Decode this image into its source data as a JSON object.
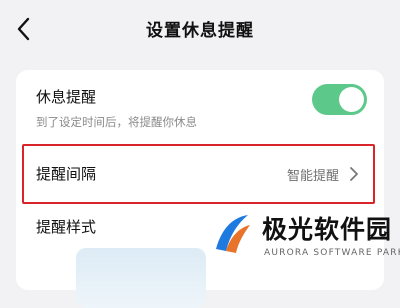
{
  "header": {
    "back_icon": "chevron-left-icon",
    "title": "设置休息提醒"
  },
  "rest_reminder": {
    "title": "休息提醒",
    "description": "到了设定时间后，将提醒你休息",
    "toggle_on": true,
    "toggle_color": "#5cc98a"
  },
  "interval": {
    "label": "提醒间隔",
    "value": "智能提醒",
    "chevron_icon": "chevron-right-icon",
    "highlight_color": "#d9242a"
  },
  "style_section": {
    "label": "提醒样式"
  },
  "watermark": {
    "logo_icon": "aurora-logo-icon",
    "name": "极光软件园",
    "subtitle": "AURORA SOFTWARE PARK"
  }
}
